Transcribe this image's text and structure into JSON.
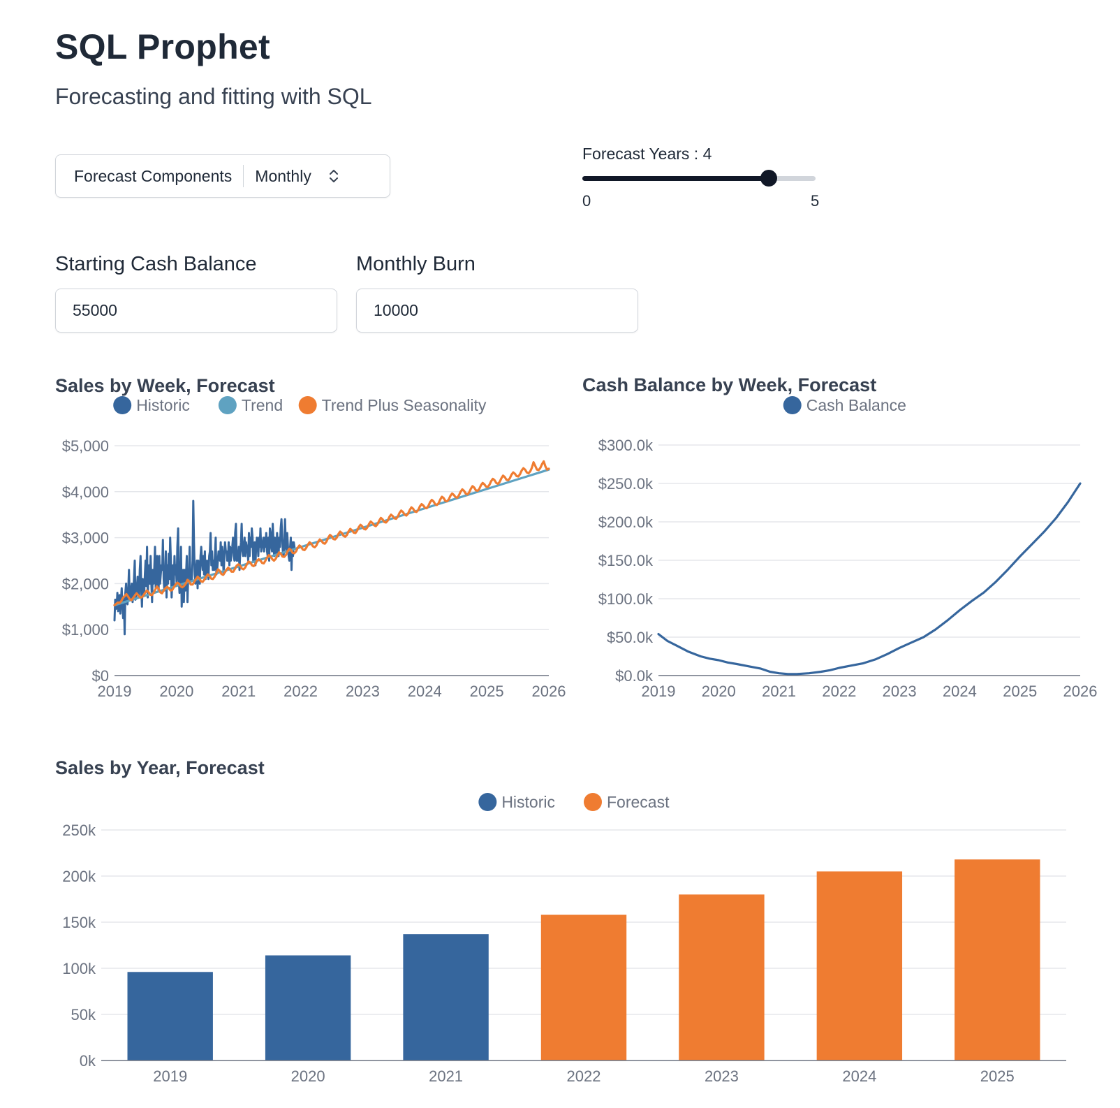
{
  "header": {
    "title": "SQL Prophet",
    "subtitle": "Forecasting and fitting with SQL"
  },
  "controls": {
    "dropdown": {
      "label": "Forecast Components",
      "value": "Monthly",
      "icon": "chevron-up-down-icon"
    },
    "slider": {
      "label": "Forecast Years : 4",
      "min": "0",
      "max": "5",
      "value": 4
    }
  },
  "inputs": {
    "starting_cash": {
      "label": "Starting Cash Balance",
      "value": "55000"
    },
    "monthly_burn": {
      "label": "Monthly Burn",
      "value": "10000"
    }
  },
  "colors": {
    "historic": "#36669d",
    "trend": "#5fa2c1",
    "seasonality": "#ef7c31",
    "forecast": "#ef7c31",
    "cash": "#36669d",
    "grid": "#e5e7eb",
    "axis": "#6b7280",
    "tick_text": "#6b7280"
  },
  "chart_data": [
    {
      "id": "weekly",
      "type": "line",
      "title": "Sales by Week, Forecast",
      "legend": [
        "Historic",
        "Trend",
        "Trend Plus Seasonality"
      ],
      "legend_position": "top-center",
      "grid": true,
      "xlim": [
        2019,
        2026
      ],
      "x_ticks": [
        "2019",
        "2020",
        "2021",
        "2022",
        "2023",
        "2024",
        "2025",
        "2026"
      ],
      "ylim": [
        0,
        5000
      ],
      "y_ticks": [
        "$0",
        "$1,000",
        "$2,000",
        "$3,000",
        "$4,000",
        "$5,000"
      ],
      "series": [
        {
          "name": "Historic",
          "x_range": [
            2019.0,
            2021.9
          ],
          "values": [
            1200,
            1650,
            1450,
            1500,
            1800,
            1400,
            1550,
            1750,
            1350,
            1650,
            1900,
            1500,
            1250,
            1700,
            900,
            1800,
            2000,
            1600,
            1550,
            1850,
            2300,
            1700,
            1650,
            1900,
            2000,
            1600,
            1800,
            2100,
            2500,
            1650,
            1700,
            1900,
            2150,
            1800,
            1700,
            2300,
            2600,
            1900,
            1500,
            2100,
            2000,
            1750,
            2200,
            2500,
            1950,
            2800,
            1700,
            2250,
            2400,
            2000,
            2600,
            2000,
            1600,
            2300,
            2000,
            2300,
            2800,
            1900,
            2200,
            2600,
            2000,
            1850,
            2600,
            2000,
            2200,
            2400,
            2300,
            2950,
            2100,
            1850,
            2000,
            2700,
            1700,
            2400,
            2000,
            2650,
            2100,
            3000,
            2500,
            1700,
            2100,
            2400,
            1950,
            2600,
            2200,
            2400,
            2000,
            2800,
            3200,
            2100,
            1800,
            2050,
            2800,
            1500,
            1900,
            2300,
            1600,
            2300,
            1850,
            2200,
            2600,
            1600,
            2200,
            2200,
            2800,
            2000,
            2300,
            2100,
            2500,
            3800,
            2900,
            2200,
            2000,
            2300,
            2500,
            1900,
            2500,
            2350,
            2000,
            2600,
            2800,
            2500,
            2300,
            2600,
            2200,
            2700,
            2100,
            2400,
            2500,
            2300,
            2100,
            2600,
            2700,
            3100,
            2400,
            2700,
            2300,
            2500,
            2300,
            2600,
            3000,
            2200,
            2300,
            2500,
            2700,
            2600,
            2500,
            2900,
            2400,
            2800,
            2600,
            2200,
            2600,
            2900,
            2700,
            2700,
            2500,
            2500,
            2900,
            2400,
            2800,
            2500,
            2700,
            2800,
            3000,
            2600,
            2500,
            3100,
            3300,
            2500,
            2500,
            2600,
            2800,
            2300,
            2700,
            2900,
            3300,
            2700,
            2600,
            2800,
            3000,
            2600,
            2900,
            2800,
            2700,
            2500,
            3100,
            2600,
            3000,
            2800,
            3200,
            3000,
            2500,
            2600,
            2900,
            2400,
            2800,
            3000,
            2900,
            2600,
            3000,
            2800,
            3200,
            2700,
            2800,
            2900,
            3000,
            2700,
            3000,
            2800,
            3100,
            2700,
            2600,
            3000,
            2500,
            3200,
            3100,
            2800,
            2700,
            3300,
            2900,
            2600,
            3000,
            2700,
            2600,
            3100,
            2800,
            2600,
            3000,
            2800,
            3200,
            3400,
            3000,
            2700,
            2600,
            2900,
            3400,
            2800,
            2700,
            3100,
            2800,
            2600,
            2500,
            2800,
            3000,
            2300,
            2900,
            2600,
            2900,
            2800
          ]
        },
        {
          "name": "Trend",
          "x": [
            2019.0,
            2026.0
          ],
          "values": [
            1530,
            4480
          ]
        },
        {
          "name": "Trend Plus Seasonality",
          "x_range": [
            2019.0,
            2026.0
          ],
          "values": [
            1530,
            1560,
            1590,
            1580,
            1620,
            1690,
            1730,
            1770,
            1720,
            1660,
            1640,
            1690,
            1740,
            1790,
            1750,
            1700,
            1700,
            1740,
            1800,
            1850,
            1820,
            1760,
            1750,
            1800,
            1870,
            1940,
            1890,
            1810,
            1790,
            1850,
            1900,
            1930,
            1900,
            1850,
            1860,
            1920,
            1980,
            2020,
            2000,
            1940,
            1920,
            1950,
            2000,
            2080,
            2050,
            1980,
            1980,
            2040,
            2100,
            2150,
            2110,
            2050,
            2040,
            2090,
            2150,
            2200,
            2170,
            2110,
            2100,
            2150,
            2230,
            2310,
            2280,
            2210,
            2190,
            2240,
            2300,
            2350,
            2310,
            2260,
            2260,
            2320,
            2390,
            2420,
            2390,
            2330,
            2310,
            2350,
            2420,
            2480,
            2460,
            2400,
            2380,
            2420,
            2500,
            2530,
            2500,
            2450,
            2440,
            2500,
            2570,
            2620,
            2590,
            2530,
            2500,
            2540,
            2610,
            2680,
            2650,
            2590,
            2580,
            2620,
            2700,
            2760,
            2730,
            2670,
            2660,
            2700,
            2780,
            2830,
            2800,
            2740,
            2730,
            2780,
            2850,
            2900,
            2870,
            2810,
            2790,
            2830,
            2910,
            2960,
            2930,
            2880,
            2870,
            2920,
            3000,
            3060,
            3030,
            2970,
            2960,
            3000,
            3080,
            3130,
            3100,
            3040,
            3020,
            3060,
            3140,
            3190,
            3160,
            3110,
            3100,
            3150,
            3230,
            3280,
            3250,
            3190,
            3180,
            3220,
            3300,
            3350,
            3320,
            3270,
            3250,
            3290,
            3370,
            3430,
            3400,
            3340,
            3330,
            3370,
            3450,
            3500,
            3470,
            3420,
            3410,
            3460,
            3540,
            3590,
            3560,
            3500,
            3480,
            3520,
            3600,
            3660,
            3630,
            3570,
            3560,
            3600,
            3680,
            3730,
            3700,
            3650,
            3640,
            3690,
            3770,
            3820,
            3790,
            3730,
            3710,
            3750,
            3830,
            3890,
            3860,
            3800,
            3790,
            3830,
            3910,
            3960,
            3930,
            3880,
            3870,
            3920,
            4000,
            4050,
            4020,
            3960,
            3940,
            3980,
            4060,
            4120,
            4090,
            4030,
            4020,
            4060,
            4140,
            4190,
            4160,
            4110,
            4100,
            4150,
            4230,
            4280,
            4250,
            4190,
            4170,
            4210,
            4290,
            4350,
            4320,
            4260,
            4250,
            4290,
            4370,
            4420,
            4390,
            4340,
            4330,
            4380,
            4460,
            4510,
            4480,
            4420,
            4400,
            4440,
            4520,
            4640,
            4560,
            4480,
            4470,
            4520,
            4600,
            4660,
            4550,
            4480,
            4500
          ]
        }
      ]
    },
    {
      "id": "cash",
      "type": "line",
      "title": "Cash Balance by Week, Forecast",
      "legend": [
        "Cash Balance"
      ],
      "legend_position": "top-center",
      "grid": true,
      "xlim": [
        2019,
        2026
      ],
      "x_ticks": [
        "2019",
        "2020",
        "2021",
        "2022",
        "2023",
        "2024",
        "2025",
        "2026"
      ],
      "ylim": [
        0,
        300000
      ],
      "y_ticks": [
        "$0.0k",
        "$50.0k",
        "$100.0k",
        "$150.0k",
        "$200.0k",
        "$250.0k",
        "$300.0k"
      ],
      "series": [
        {
          "name": "Cash Balance",
          "x": [
            2019.0,
            2019.15,
            2019.3,
            2019.5,
            2019.7,
            2019.85,
            2020.0,
            2020.15,
            2020.3,
            2020.5,
            2020.7,
            2020.85,
            2021.0,
            2021.15,
            2021.3,
            2021.5,
            2021.7,
            2021.85,
            2022.0,
            2022.2,
            2022.4,
            2022.6,
            2022.8,
            2023.0,
            2023.2,
            2023.4,
            2023.6,
            2023.8,
            2024.0,
            2024.2,
            2024.4,
            2024.6,
            2024.8,
            2025.0,
            2025.2,
            2025.4,
            2025.6,
            2025.8,
            2026.0
          ],
          "values": [
            54000,
            45000,
            39000,
            31000,
            25000,
            22000,
            20000,
            17000,
            15000,
            12000,
            9000,
            5000,
            3000,
            2000,
            2000,
            3000,
            5000,
            7000,
            10000,
            13000,
            16000,
            21000,
            28000,
            36000,
            43000,
            50000,
            60000,
            72000,
            85000,
            97000,
            108000,
            122000,
            138000,
            155000,
            171000,
            187000,
            205000,
            226000,
            250000
          ]
        }
      ]
    },
    {
      "id": "yearly",
      "type": "bar",
      "title": "Sales by Year, Forecast",
      "legend": [
        "Historic",
        "Forecast"
      ],
      "legend_position": "top-center",
      "grid": true,
      "categories": [
        "2019",
        "2020",
        "2021",
        "2022",
        "2023",
        "2024",
        "2025"
      ],
      "ylim": [
        0,
        250000
      ],
      "y_ticks": [
        "0k",
        "50k",
        "100k",
        "150k",
        "200k",
        "250k"
      ],
      "series": [
        {
          "name": "Historic",
          "values": [
            96000,
            114000,
            137000,
            null,
            null,
            null,
            null
          ]
        },
        {
          "name": "Forecast",
          "values": [
            null,
            null,
            null,
            158000,
            180000,
            205000,
            218000
          ]
        }
      ]
    }
  ]
}
